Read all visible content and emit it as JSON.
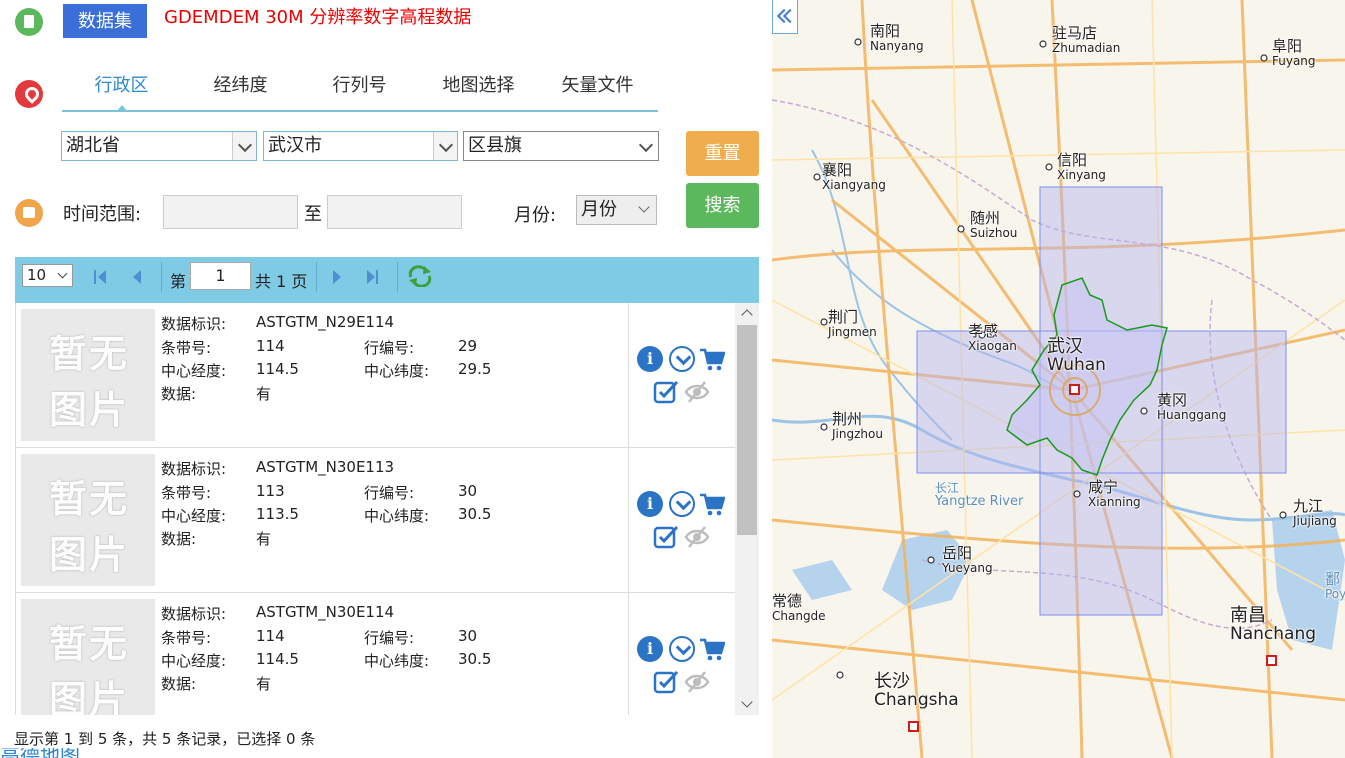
{
  "header": {
    "dataset_button": "数据集",
    "dataset_title": "GDEMDEM 30M 分辨率数字高程数据"
  },
  "tabs": [
    {
      "label": "行政区",
      "active": true
    },
    {
      "label": "经纬度",
      "active": false
    },
    {
      "label": "行列号",
      "active": false
    },
    {
      "label": "地图选择",
      "active": false
    },
    {
      "label": "矢量文件",
      "active": false
    }
  ],
  "region": {
    "province": "湖北省",
    "city": "武汉市",
    "county": "区县旗"
  },
  "buttons": {
    "reset": "重置",
    "search": "搜索"
  },
  "time": {
    "label": "时间范围:",
    "to": "至",
    "month_label": "月份:",
    "month_value": "月份"
  },
  "pager": {
    "page_size": "10",
    "page_prefix": "第",
    "page_value": "1",
    "page_suffix": "共 1 页"
  },
  "labels": {
    "id": "数据标识:",
    "strip": "条带号:",
    "row": "行编号:",
    "center_lon": "中心经度:",
    "center_lat": "中心纬度:",
    "data": "数据:",
    "placeholder_line1": "暂无",
    "placeholder_line2": "图片"
  },
  "records": [
    {
      "id": "ASTGTM_N29E114",
      "strip": "114",
      "row": "29",
      "center_lon": "114.5",
      "center_lat": "29.5",
      "data": "有"
    },
    {
      "id": "ASTGTM_N30E113",
      "strip": "113",
      "row": "30",
      "center_lon": "113.5",
      "center_lat": "30.5",
      "data": "有"
    },
    {
      "id": "ASTGTM_N30E114",
      "strip": "114",
      "row": "30",
      "center_lon": "114.5",
      "center_lat": "30.5",
      "data": "有"
    }
  ],
  "footer": {
    "summary": "显示第 1 到 5 条，共 5 条记录，已选择 0 条",
    "logo": "高德地图"
  },
  "map": {
    "cities": [
      {
        "zh": "南阳",
        "en": "Nanyang"
      },
      {
        "zh": "驻马店",
        "en": "Zhumadian"
      },
      {
        "zh": "阜阳",
        "en": "Fuyang"
      },
      {
        "zh": "信阳",
        "en": "Xinyang"
      },
      {
        "zh": "襄阳",
        "en": "Xiangyang"
      },
      {
        "zh": "随州",
        "en": "Suizhou"
      },
      {
        "zh": "荆门",
        "en": "Jingmen"
      },
      {
        "zh": "孝感",
        "en": "Xiaogan"
      },
      {
        "zh": "武汉",
        "en": "Wuhan"
      },
      {
        "zh": "黄冈",
        "en": "Huanggang"
      },
      {
        "zh": "荆州",
        "en": "Jingzhou"
      },
      {
        "zh": "咸宁",
        "en": "Xianning"
      },
      {
        "zh": "长江",
        "en": "Yangtze River"
      },
      {
        "zh": "九江",
        "en": "Jiujiang"
      },
      {
        "zh": "岳阳",
        "en": "Yueyang"
      },
      {
        "zh": "常德",
        "en": "Changde"
      },
      {
        "zh": "南昌",
        "en": "Nanchang"
      },
      {
        "zh": "长沙",
        "en": "Changsha"
      },
      {
        "zh": "鄱",
        "en": "Poyan"
      }
    ]
  },
  "colors": {
    "accent_blue": "#3a6fd8",
    "title_red": "#e00000",
    "reset_orange": "#f0ad4e",
    "search_green": "#5cb85c",
    "pager_bg": "#7fcbe6",
    "tile_fill": "#b4b4f0",
    "boundary_green": "#1a9a1a"
  }
}
